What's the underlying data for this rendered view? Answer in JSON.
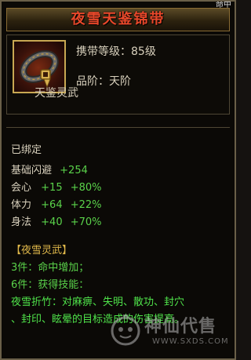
{
  "tooltip": {
    "corner_tab": "命中",
    "title": "夜雪天鉴锦带",
    "carry_level": "携带等级：85级",
    "grade": "品阶：天阶",
    "item_name": "天鉴灵武",
    "bound": "已绑定",
    "stats": [
      {
        "name": "基础闪避",
        "value": "+254"
      },
      {
        "name": "会心",
        "value": "+15",
        "pct": "+80%"
      },
      {
        "name": "体力",
        "value": "+64",
        "pct": "+22%"
      },
      {
        "name": "身法",
        "value": "+40",
        "pct": "+70%"
      }
    ],
    "set_name": "【夜雪灵武】",
    "set_bonus_3": "3件：命中增加；",
    "set_bonus_6": "6件：获得技能：",
    "skill_line1": "夜雪折竹：对麻痹、失明、散功、封穴",
    "skill_line2": "、封印、眩晕的目标造成的伤害提高。"
  },
  "watermark": {
    "brand": "神仙代售",
    "url": "WWW.SXDS.COM"
  },
  "colors": {
    "title_red": "#e8482a",
    "gold": "#e0b84a",
    "green": "#5ad24a",
    "panel_border": "#6a5f48"
  },
  "icons": {
    "item": "belt-icon",
    "watermark": "gourd-logo-icon"
  }
}
